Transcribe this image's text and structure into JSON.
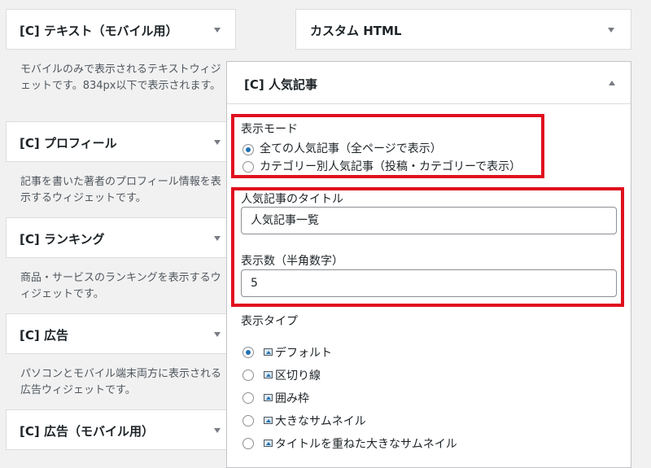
{
  "left_widgets": [
    {
      "title": "[C] テキスト（モバイル用）",
      "desc": "モバイルのみで表示されるテキストウィジェットです。834px以下で表示されます。"
    },
    {
      "title": "[C] プロフィール",
      "desc": "記事を書いた著者のプロフィール情報を表示するウィジェットです。"
    },
    {
      "title": "[C] ランキング",
      "desc": "商品・サービスのランキングを表示するウィジェットです。"
    },
    {
      "title": "[C] 広告",
      "desc": "パソコンとモバイル端末両方に表示される広告ウィジェットです。"
    },
    {
      "title": "[C] 広告（モバイル用）"
    }
  ],
  "custom_html": {
    "title": "カスタム HTML"
  },
  "panel": {
    "title": "[C] 人気記事",
    "display_mode": {
      "label": "表示モード",
      "options": [
        {
          "label": "全ての人気記事（全ページで表示）",
          "checked": true
        },
        {
          "label": "カテゴリー別人気記事（投稿・カテゴリーで表示）",
          "checked": false
        }
      ]
    },
    "title_field": {
      "label": "人気記事のタイトル",
      "value": "人気記事一覧"
    },
    "count_field": {
      "label": "表示数（半角数字）",
      "value": "5"
    },
    "display_type": {
      "label": "表示タイプ",
      "options": [
        {
          "label": "デフォルト",
          "checked": true,
          "icon": "image-icon"
        },
        {
          "label": "区切り線",
          "checked": false,
          "icon": "image-icon"
        },
        {
          "label": "囲み枠",
          "checked": false,
          "icon": "image-icon"
        },
        {
          "label": "大きなサムネイル",
          "checked": false,
          "icon": "image-icon"
        },
        {
          "label": "タイトルを重ねた大きなサムネイル",
          "checked": false,
          "icon": "image-icon"
        }
      ]
    }
  },
  "colors": {
    "highlight": "#e0101e",
    "accent": "#2271b1",
    "background": "#f1f1f1"
  }
}
